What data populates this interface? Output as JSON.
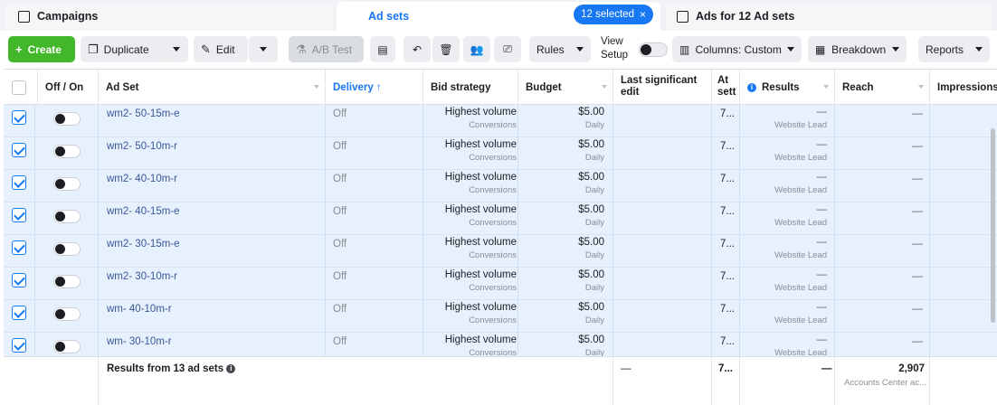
{
  "tabs": {
    "campaigns": "Campaigns",
    "adsets": "Ad sets",
    "ads": "Ads for 12 Ad sets",
    "selected_pill": "12 selected",
    "selected_close": "×"
  },
  "toolbar": {
    "create": "Create",
    "duplicate": "Duplicate",
    "edit": "Edit",
    "ab_test": "A/B Test",
    "rules": "Rules",
    "view_setup_line1": "View",
    "view_setup_line2": "Setup",
    "columns": "Columns: Custom",
    "breakdown": "Breakdown",
    "reports": "Reports"
  },
  "table": {
    "headers": {
      "onoff": "Off / On",
      "adset": "Ad Set",
      "delivery": "Delivery ↑",
      "bid": "Bid strategy",
      "budget": "Budget",
      "last_edit_1": "Last significant",
      "last_edit_2": "edit",
      "attr_1": "At",
      "attr_2": "sett",
      "results": "Results",
      "reach": "Reach",
      "impressions": "Impressions"
    },
    "rows": [
      {
        "name": "wm2- 50-15m-e",
        "delivery": "Off",
        "bid": "Highest volume",
        "bid_sub": "Conversions",
        "budget": "$5.00",
        "budget_sub": "Daily",
        "attr": "7...",
        "results": "—",
        "results_sub": "Website Lead",
        "reach": "—"
      },
      {
        "name": "wm2- 50-10m-r",
        "delivery": "Off",
        "bid": "Highest volume",
        "bid_sub": "Conversions",
        "budget": "$5.00",
        "budget_sub": "Daily",
        "attr": "7...",
        "results": "—",
        "results_sub": "Website Lead",
        "reach": "—"
      },
      {
        "name": "wm2- 40-10m-r",
        "delivery": "Off",
        "bid": "Highest volume",
        "bid_sub": "Conversions",
        "budget": "$5.00",
        "budget_sub": "Daily",
        "attr": "7...",
        "results": "—",
        "results_sub": "Website Lead",
        "reach": "—"
      },
      {
        "name": "wm2- 40-15m-e",
        "delivery": "Off",
        "bid": "Highest volume",
        "bid_sub": "Conversions",
        "budget": "$5.00",
        "budget_sub": "Daily",
        "attr": "7...",
        "results": "—",
        "results_sub": "Website Lead",
        "reach": "—"
      },
      {
        "name": "wm2- 30-15m-e",
        "delivery": "Off",
        "bid": "Highest volume",
        "bid_sub": "Conversions",
        "budget": "$5.00",
        "budget_sub": "Daily",
        "attr": "7...",
        "results": "—",
        "results_sub": "Website Lead",
        "reach": "—"
      },
      {
        "name": "wm2- 30-10m-r",
        "delivery": "Off",
        "bid": "Highest volume",
        "bid_sub": "Conversions",
        "budget": "$5.00",
        "budget_sub": "Daily",
        "attr": "7...",
        "results": "—",
        "results_sub": "Website Lead",
        "reach": "—"
      },
      {
        "name": "wm- 40-10m-r",
        "delivery": "Off",
        "bid": "Highest volume",
        "bid_sub": "Conversions",
        "budget": "$5.00",
        "budget_sub": "Daily",
        "attr": "7...",
        "results": "—",
        "results_sub": "Website Lead",
        "reach": "—"
      },
      {
        "name": "wm- 30-10m-r",
        "delivery": "Off",
        "bid": "Highest volume",
        "bid_sub": "Conversions",
        "budget": "$5.00",
        "budget_sub": "Daily",
        "attr": "7...",
        "results": "—",
        "results_sub": "Website Lead",
        "reach": "—"
      }
    ],
    "footer": {
      "label": "Results from 13 ad sets",
      "info": "i",
      "last_edit": "—",
      "attr": "7...",
      "results": "—",
      "reach": "2,907",
      "reach_sub": "Accounts Center ac..."
    }
  },
  "colors": {
    "accent": "#1877f2",
    "create_green": "#42b72a",
    "row_selected": "#e7f0fd"
  }
}
